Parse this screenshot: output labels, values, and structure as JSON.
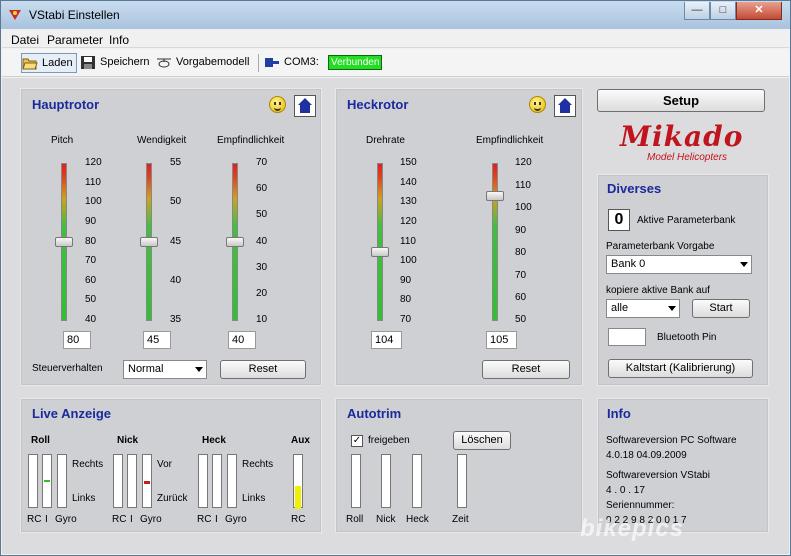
{
  "window": {
    "title": "VStabi Einstellen",
    "min_glyph": "—",
    "max_glyph": "□",
    "close_glyph": "✕"
  },
  "menu": {
    "items": [
      "Datei",
      "Parameter",
      "Info"
    ]
  },
  "toolbar": {
    "load": "Laden",
    "save": "Speichern",
    "preset": "Vorgabemodell",
    "port": "COM3:",
    "status": "Verbunden",
    "status_color": "#22dd22"
  },
  "hauptrotor": {
    "title": "Hauptrotor",
    "sliders": [
      {
        "label": "Pitch",
        "ticks": [
          "120",
          "110",
          "100",
          "90",
          "80",
          "70",
          "60",
          "50",
          "40"
        ],
        "value": "80"
      },
      {
        "label": "Wendigkeit",
        "ticks": [
          "55",
          "50",
          "45",
          "40",
          "35"
        ],
        "value": "45"
      },
      {
        "label": "Empfindlichkeit",
        "ticks": [
          "70",
          "60",
          "50",
          "40",
          "30",
          "20",
          "10"
        ],
        "value": "40"
      }
    ],
    "steuer_label": "Steuerverhalten",
    "steuer_value": "Normal",
    "reset": "Reset"
  },
  "heckrotor": {
    "title": "Heckrotor",
    "sliders": [
      {
        "label": "Drehrate",
        "ticks": [
          "150",
          "140",
          "130",
          "120",
          "110",
          "100",
          "90",
          "80",
          "70"
        ],
        "value": "104"
      },
      {
        "label": "Empfindlichkeit",
        "ticks": [
          "120",
          "110",
          "100",
          "90",
          "80",
          "70",
          "60",
          "50"
        ],
        "value": "105"
      }
    ],
    "reset": "Reset"
  },
  "setup": {
    "label": "Setup"
  },
  "logo": {
    "brand": "Mikado",
    "sub": "Model Helicopters"
  },
  "diverses": {
    "title": "Diverses",
    "bank_digit": "0",
    "bank_label": "Aktive Parameterbank",
    "vorgabe_label": "Parameterbank Vorgabe",
    "vorgabe_value": "Bank 0",
    "kopiere_label": "kopiere aktive Bank auf",
    "kopiere_value": "alle",
    "start": "Start",
    "bt_label": "Bluetooth Pin",
    "kaltstart": "Kaltstart (Kalibrierung)"
  },
  "live": {
    "title": "Live Anzeige",
    "groups": [
      {
        "name": "Roll",
        "top": "Rechts",
        "bottom": "Links"
      },
      {
        "name": "Nick",
        "top": "Vor",
        "bottom": "Zurück"
      },
      {
        "name": "Heck",
        "top": "Rechts",
        "bottom": "Links"
      }
    ],
    "sub_labels": [
      "RC",
      "I",
      "Gyro"
    ],
    "aux": {
      "name": "Aux",
      "sub": "RC",
      "level_fraction": 0.45,
      "color": "#f0f000"
    }
  },
  "autotrim": {
    "title": "Autotrim",
    "check_label": "freigeben",
    "check_mark": "✓",
    "clear": "Löschen",
    "bars": [
      "Roll",
      "Nick",
      "Heck",
      "Zeit"
    ]
  },
  "info": {
    "title": "Info",
    "pc_label": "Softwareversion PC Software",
    "pc_value": "4.0.18  04.09.2009",
    "vstabi_label": "Softwareversion VStabi",
    "vstabi_value": "4 . 0 . 17",
    "serial_label": "Seriennummer:",
    "serial_value": "9 2 2 9 8 2 0 0 1 7"
  },
  "watermark": "bikepics"
}
